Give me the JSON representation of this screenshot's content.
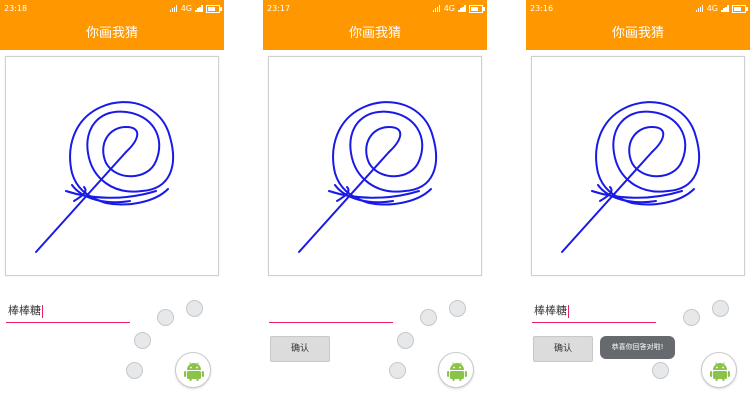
{
  "colors": {
    "accent": "#ff9800",
    "stroke": "#1a1ae6",
    "underline": "#e91e63",
    "android_green": "#8bc34a"
  },
  "screens": [
    {
      "status_time": "23:18",
      "network": "4G",
      "title": "你画我猜",
      "answer_value": "棒棒糖",
      "confirm_label": "",
      "toast_text": ""
    },
    {
      "status_time": "23:17",
      "network": "4G",
      "title": "你画我猜",
      "answer_value": "",
      "confirm_label": "确认",
      "toast_text": ""
    },
    {
      "status_time": "23:16",
      "network": "4G",
      "title": "你画我猜",
      "answer_value": "棒棒糖",
      "confirm_label": "确认",
      "toast_text": "恭喜你回答对啦!"
    }
  ]
}
